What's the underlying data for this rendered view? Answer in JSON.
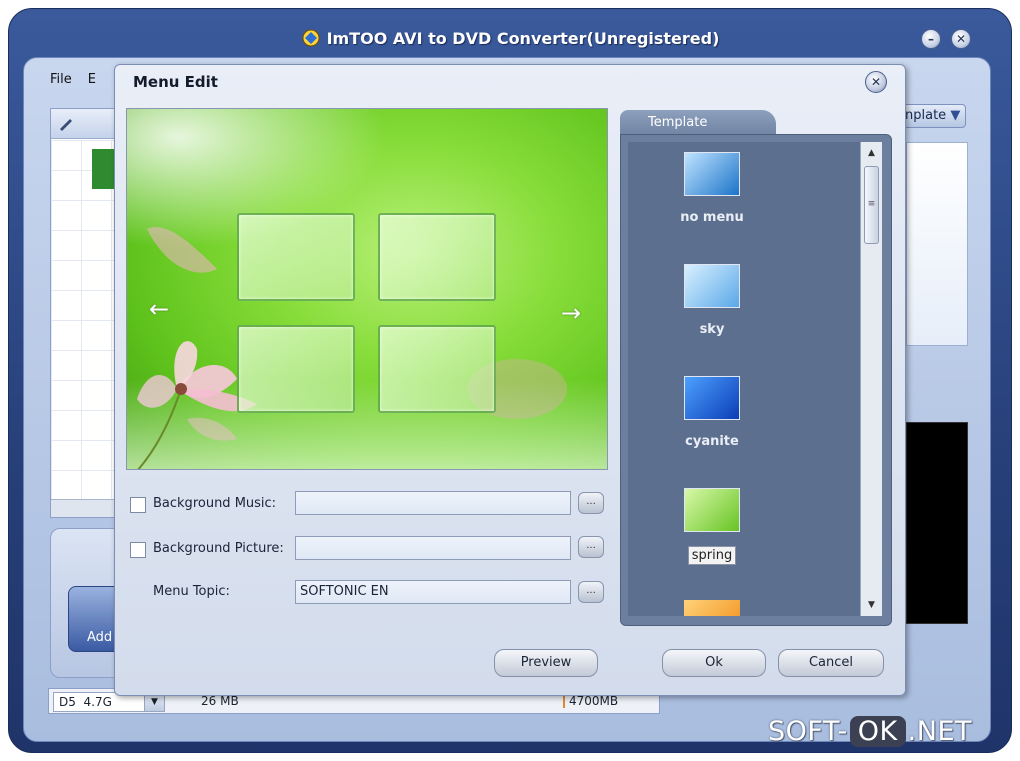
{
  "app": {
    "title": "ImTOO AVI to DVD Converter(Unregistered)",
    "menu": [
      "File",
      "E"
    ],
    "add_label": "Add",
    "template_dropdown": "nplate",
    "status": {
      "disc_type": "D5",
      "disc_size": "4.7G",
      "used": "26 MB",
      "total": "4700MB"
    }
  },
  "dialog": {
    "title": "Menu Edit",
    "close_glyph": "✕",
    "rows": {
      "bg_music_label": "Background Music:",
      "bg_music_value": "",
      "bg_picture_label": "Background Picture:",
      "bg_picture_value": "",
      "topic_label": "Menu Topic:",
      "topic_value": "SOFTONIC EN",
      "browse_glyph": "..."
    },
    "template_tab": "Template",
    "templates": [
      {
        "name": "no menu",
        "selected": false,
        "colors": [
          "#1c74c9",
          "#bfe3ff"
        ]
      },
      {
        "name": "sky",
        "selected": false,
        "colors": [
          "#5aa8e8",
          "#d9f0ff"
        ]
      },
      {
        "name": "cyanite",
        "selected": false,
        "colors": [
          "#0a3db5",
          "#4da0ff"
        ]
      },
      {
        "name": "spring",
        "selected": true,
        "colors": [
          "#67c424",
          "#d8f8a8"
        ]
      }
    ],
    "buttons": {
      "preview": "Preview",
      "ok": "Ok",
      "cancel": "Cancel"
    }
  },
  "watermark": {
    "left": "SOFT-",
    "box": "OK",
    "right": ".NET"
  }
}
